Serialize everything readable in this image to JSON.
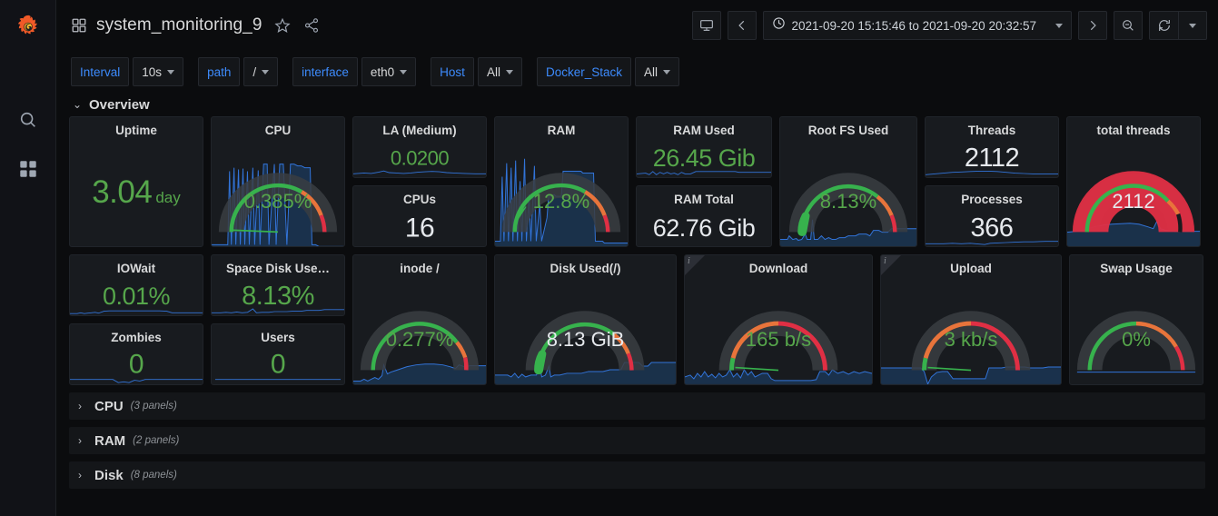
{
  "brand": {
    "logo": "grafana-logo"
  },
  "nav": {
    "items": [
      {
        "name": "search-icon",
        "label": "Search"
      },
      {
        "name": "dashboards-icon",
        "label": "Dashboards"
      }
    ]
  },
  "header": {
    "grid_icon": "dashboard-grid-icon",
    "title": "system_monitoring_9",
    "star_icon": "star-icon",
    "share_icon": "share-icon",
    "tv_button": "tv-mode-icon",
    "prev_button": "chevron-left-icon",
    "next_button": "chevron-right-icon",
    "zoom_out_button": "zoom-out-icon",
    "refresh_button": "refresh-icon",
    "refresh_interval_caret": "chevron-down-icon",
    "time_range": "2021-09-20 15:15:46 to 2021-09-20 20:32:57",
    "time_range_icon": "clock-icon"
  },
  "variables": [
    {
      "label": "Interval",
      "value": "10s"
    },
    {
      "label": "path",
      "value": "/"
    },
    {
      "label": "interface",
      "value": "eth0"
    },
    {
      "label": "Host",
      "value": "All"
    },
    {
      "label": "Docker_Stack",
      "value": "All"
    }
  ],
  "rows": [
    {
      "name": "Overview",
      "count": "",
      "collapsed": false
    },
    {
      "name": "CPU",
      "count": "(3 panels)",
      "collapsed": true
    },
    {
      "name": "RAM",
      "count": "(2 panels)",
      "collapsed": true
    },
    {
      "name": "Disk",
      "count": "(8 panels)",
      "collapsed": true
    }
  ],
  "colors": {
    "green": "#56a64b",
    "gauge_green": "#37b24d",
    "gauge_orange": "#e8743b",
    "gauge_red": "#e02f44",
    "gauge_track": "#3a3d42",
    "spark_line": "#3274d9",
    "text_white": "#e6e9ed",
    "accent_blue": "#3d8bfd"
  },
  "panels": {
    "uptime": {
      "title": "Uptime",
      "type": "stat",
      "value": "3.04",
      "unit": "day",
      "color": "green"
    },
    "cpu": {
      "title": "CPU",
      "type": "gauge",
      "value": "0.385%",
      "pct": 0.385,
      "color": "green"
    },
    "la_medium": {
      "title": "LA (Medium)",
      "type": "stat",
      "value": "0.0200",
      "unit": "",
      "color": "green"
    },
    "cpus": {
      "title": "CPUs",
      "type": "stat",
      "value": "16",
      "unit": "",
      "color": "white"
    },
    "ram": {
      "title": "RAM",
      "type": "gauge",
      "value": "12.8%",
      "pct": 12.8,
      "color": "green"
    },
    "ram_used": {
      "title": "RAM Used",
      "type": "stat",
      "value": "26.45 Gib",
      "unit": "",
      "color": "green"
    },
    "ram_total": {
      "title": "RAM Total",
      "type": "stat",
      "value": "62.76 Gib",
      "unit": "",
      "color": "white"
    },
    "root_fs_used": {
      "title": "Root FS Used",
      "type": "gauge",
      "value": "8.13%",
      "pct": 8.13,
      "color": "green"
    },
    "threads": {
      "title": "Threads",
      "type": "stat",
      "value": "2112",
      "unit": "",
      "color": "white"
    },
    "processes": {
      "title": "Processes",
      "type": "stat",
      "value": "366",
      "unit": "",
      "color": "white"
    },
    "total_threads": {
      "title": "total threads",
      "type": "gauge",
      "value": "2112",
      "pct": 97,
      "color": "white"
    },
    "iowait": {
      "title": "IOWait",
      "type": "stat",
      "value": "0.01%",
      "unit": "",
      "color": "green"
    },
    "space_disk": {
      "title": "Space Disk Use…",
      "type": "stat",
      "value": "8.13%",
      "unit": "",
      "color": "green"
    },
    "zombies": {
      "title": "Zombies",
      "type": "stat",
      "value": "0",
      "unit": "",
      "color": "green"
    },
    "users": {
      "title": "Users",
      "type": "stat",
      "value": "0",
      "unit": "",
      "color": "green"
    },
    "inode": {
      "title": "inode /",
      "type": "gauge",
      "value": "0.277%",
      "pct": 0.277,
      "color": "green"
    },
    "disk_used": {
      "title": "Disk Used(/)",
      "type": "gauge",
      "value": "8.13 GiB",
      "pct": 8.13,
      "color": "white"
    },
    "download": {
      "title": "Download",
      "type": "gauge",
      "value": "165 b/s",
      "pct": 3,
      "color": "green",
      "info": "i"
    },
    "upload": {
      "title": "Upload",
      "type": "gauge",
      "value": "3 kb/s",
      "pct": 3,
      "color": "green",
      "info": "i"
    },
    "swap_usage": {
      "title": "Swap Usage",
      "type": "gauge",
      "value": "0%",
      "pct": 0,
      "color": "green"
    }
  }
}
